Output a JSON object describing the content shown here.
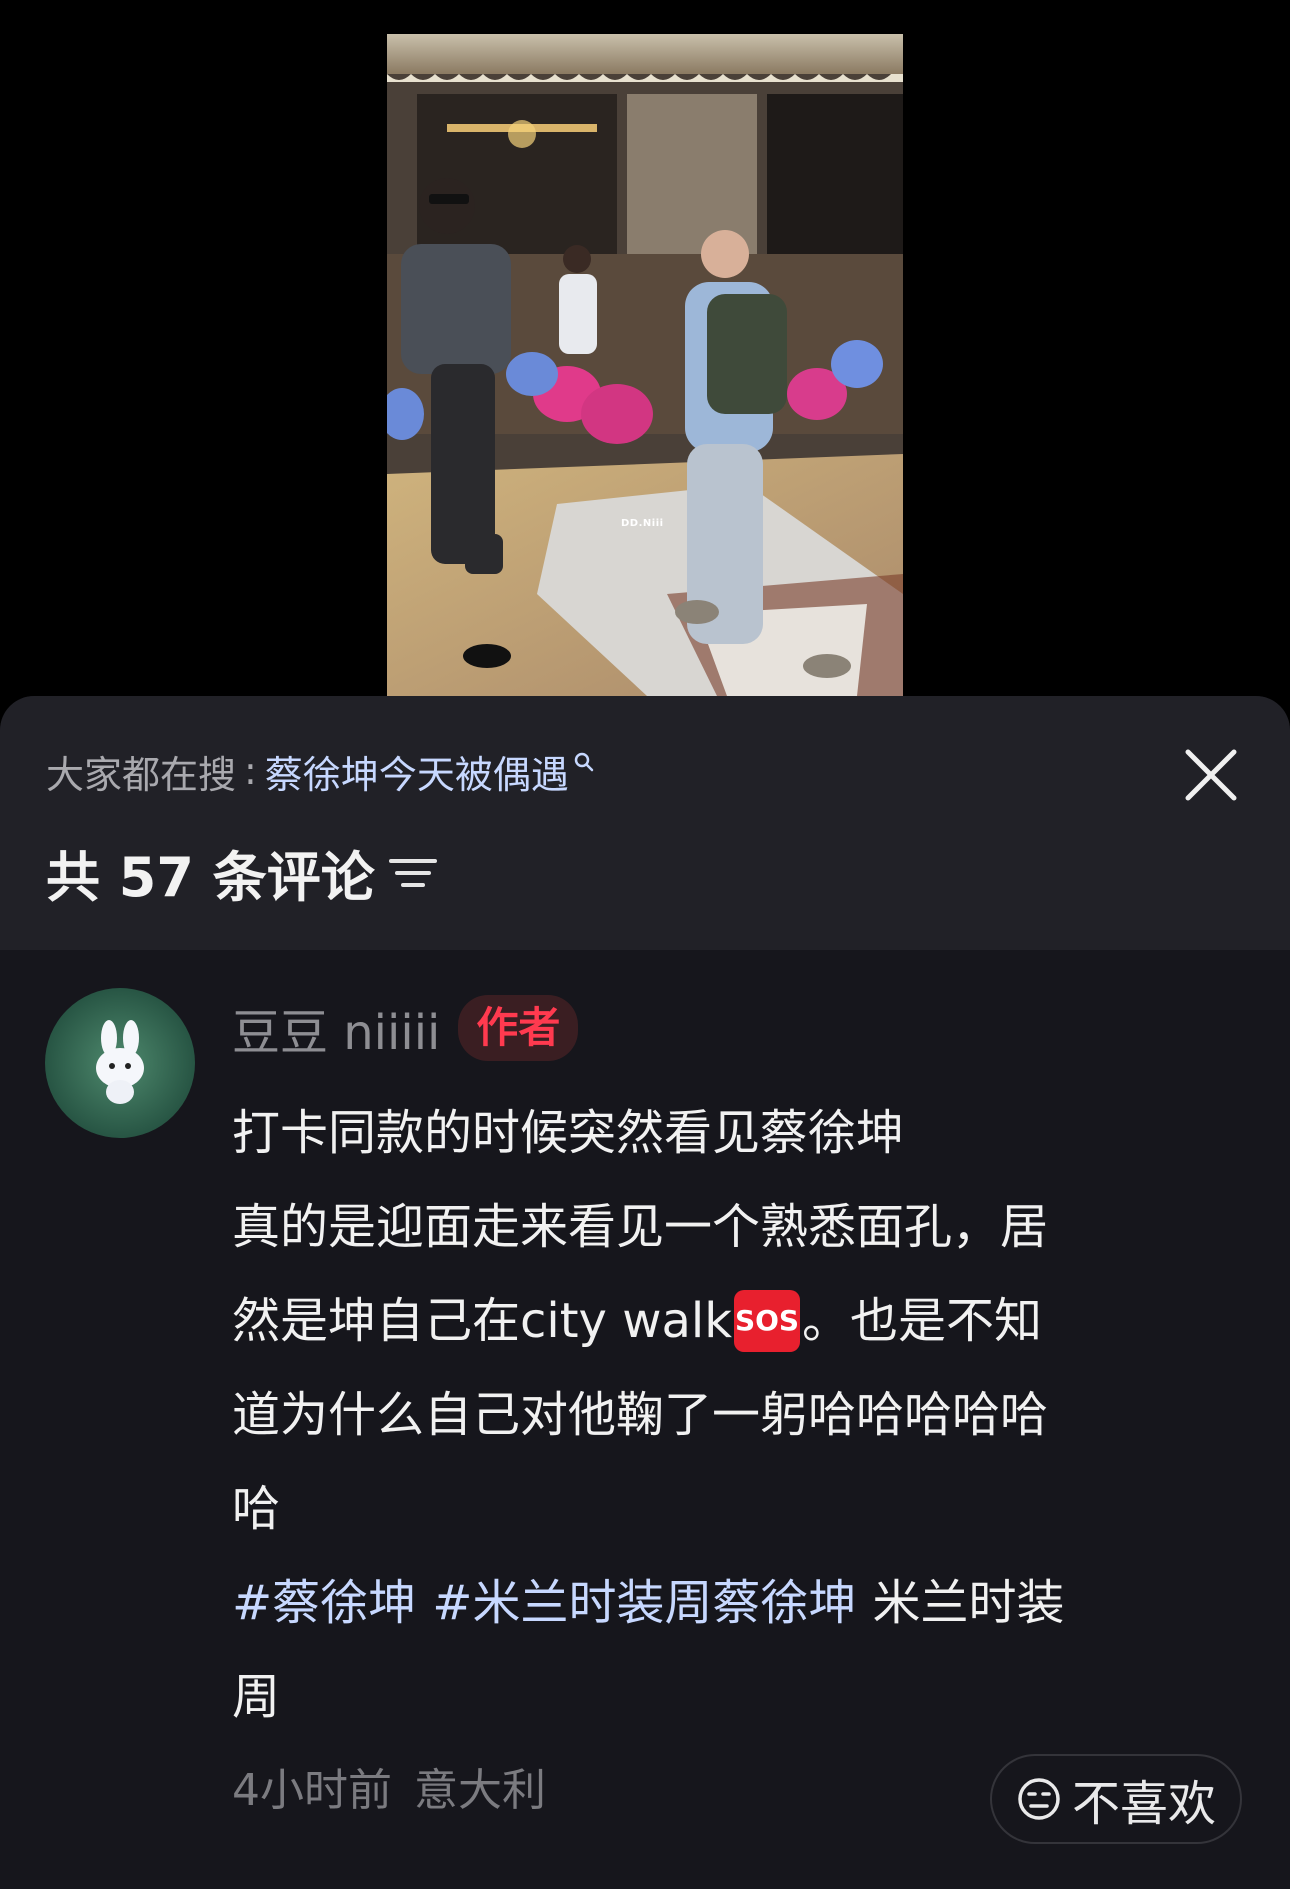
{
  "video": {
    "watermark": "DD.Niii"
  },
  "sheet": {
    "hot_search_prefix": "大家都在搜",
    "hot_search_colon": ":",
    "hot_search_term": "蔡徐坤今天被偶遇",
    "comment_count_label": "共 57 条评论",
    "icons": {
      "search": "search-icon",
      "close": "close-icon",
      "sort": "sort-icon",
      "dislike": "neutral-face-icon"
    }
  },
  "comment": {
    "author": "豆豆 niiiii",
    "badge": "作者",
    "lines": [
      "打卡同款的时候突然看见蔡徐坤",
      "真的是迎面走来看见一个熟悉面孔，居",
      "然是坤自己在city walk",
      "。也是不知",
      "道为什么自己对他鞠了一躬哈哈哈哈哈",
      "哈"
    ],
    "sos_emoji": "SOS",
    "hashtags": {
      "tag1": "#蔡徐坤",
      "tag2": "#米兰时装周蔡徐坤",
      "plain1": "米兰时装",
      "plain2": "周"
    },
    "time": "4小时前",
    "location": "意大利",
    "dislike_label": "不喜欢"
  },
  "colors": {
    "sheet_bg": "#16161c",
    "sheet_header_bg": "#212127",
    "link_blue": "#c7d8ff",
    "author_badge_red": "#ff3a4f"
  }
}
